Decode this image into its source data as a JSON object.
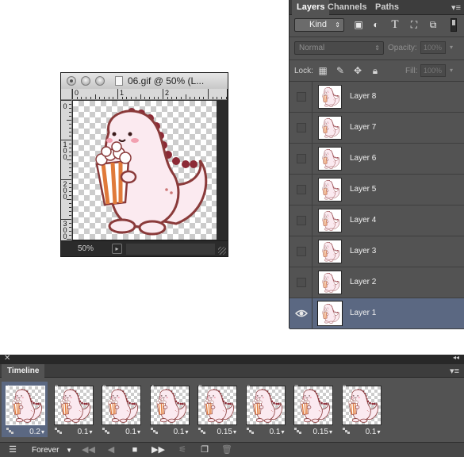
{
  "document": {
    "title": "06.gif @ 50% (L...",
    "zoom": "50%",
    "ruler_top_labels": [
      "0",
      "1",
      "2"
    ],
    "ruler_left_labels": [
      "0",
      "100",
      "200",
      "300"
    ]
  },
  "layers_panel": {
    "tabs": [
      "Layers",
      "Channels",
      "Paths"
    ],
    "active_tab": "Layers",
    "filter_kind": "Kind",
    "blend_mode": "Normal",
    "opacity_label": "Opacity:",
    "opacity_value": "100%",
    "lock_label": "Lock:",
    "fill_label": "Fill:",
    "fill_value": "100%",
    "layers": [
      {
        "name": "Layer 8",
        "visible": false
      },
      {
        "name": "Layer 7",
        "visible": false
      },
      {
        "name": "Layer 6",
        "visible": false
      },
      {
        "name": "Layer 5",
        "visible": false
      },
      {
        "name": "Layer 4",
        "visible": false
      },
      {
        "name": "Layer 3",
        "visible": false
      },
      {
        "name": "Layer 2",
        "visible": false
      },
      {
        "name": "Layer 1",
        "visible": true,
        "selected": true
      }
    ]
  },
  "timeline": {
    "tab": "Timeline",
    "frames": [
      {
        "num": "1",
        "delay": "0.2",
        "selected": true
      },
      {
        "num": "2",
        "delay": "0.1"
      },
      {
        "num": "3",
        "delay": "0.1"
      },
      {
        "num": "4",
        "delay": "0.1"
      },
      {
        "num": "5",
        "delay": "0.15"
      },
      {
        "num": "6",
        "delay": "0.1"
      },
      {
        "num": "7",
        "delay": "0.15"
      },
      {
        "num": "8",
        "delay": "0.1"
      }
    ],
    "loop": "Forever"
  },
  "colors": {
    "panel_bg": "#535353",
    "selection": "#5b6882",
    "dino_body": "#fbeaf0",
    "dino_outline": "#8a3a3a",
    "dino_spikes": "#8c2a36",
    "popcorn_stripe": "#e07a3a"
  }
}
